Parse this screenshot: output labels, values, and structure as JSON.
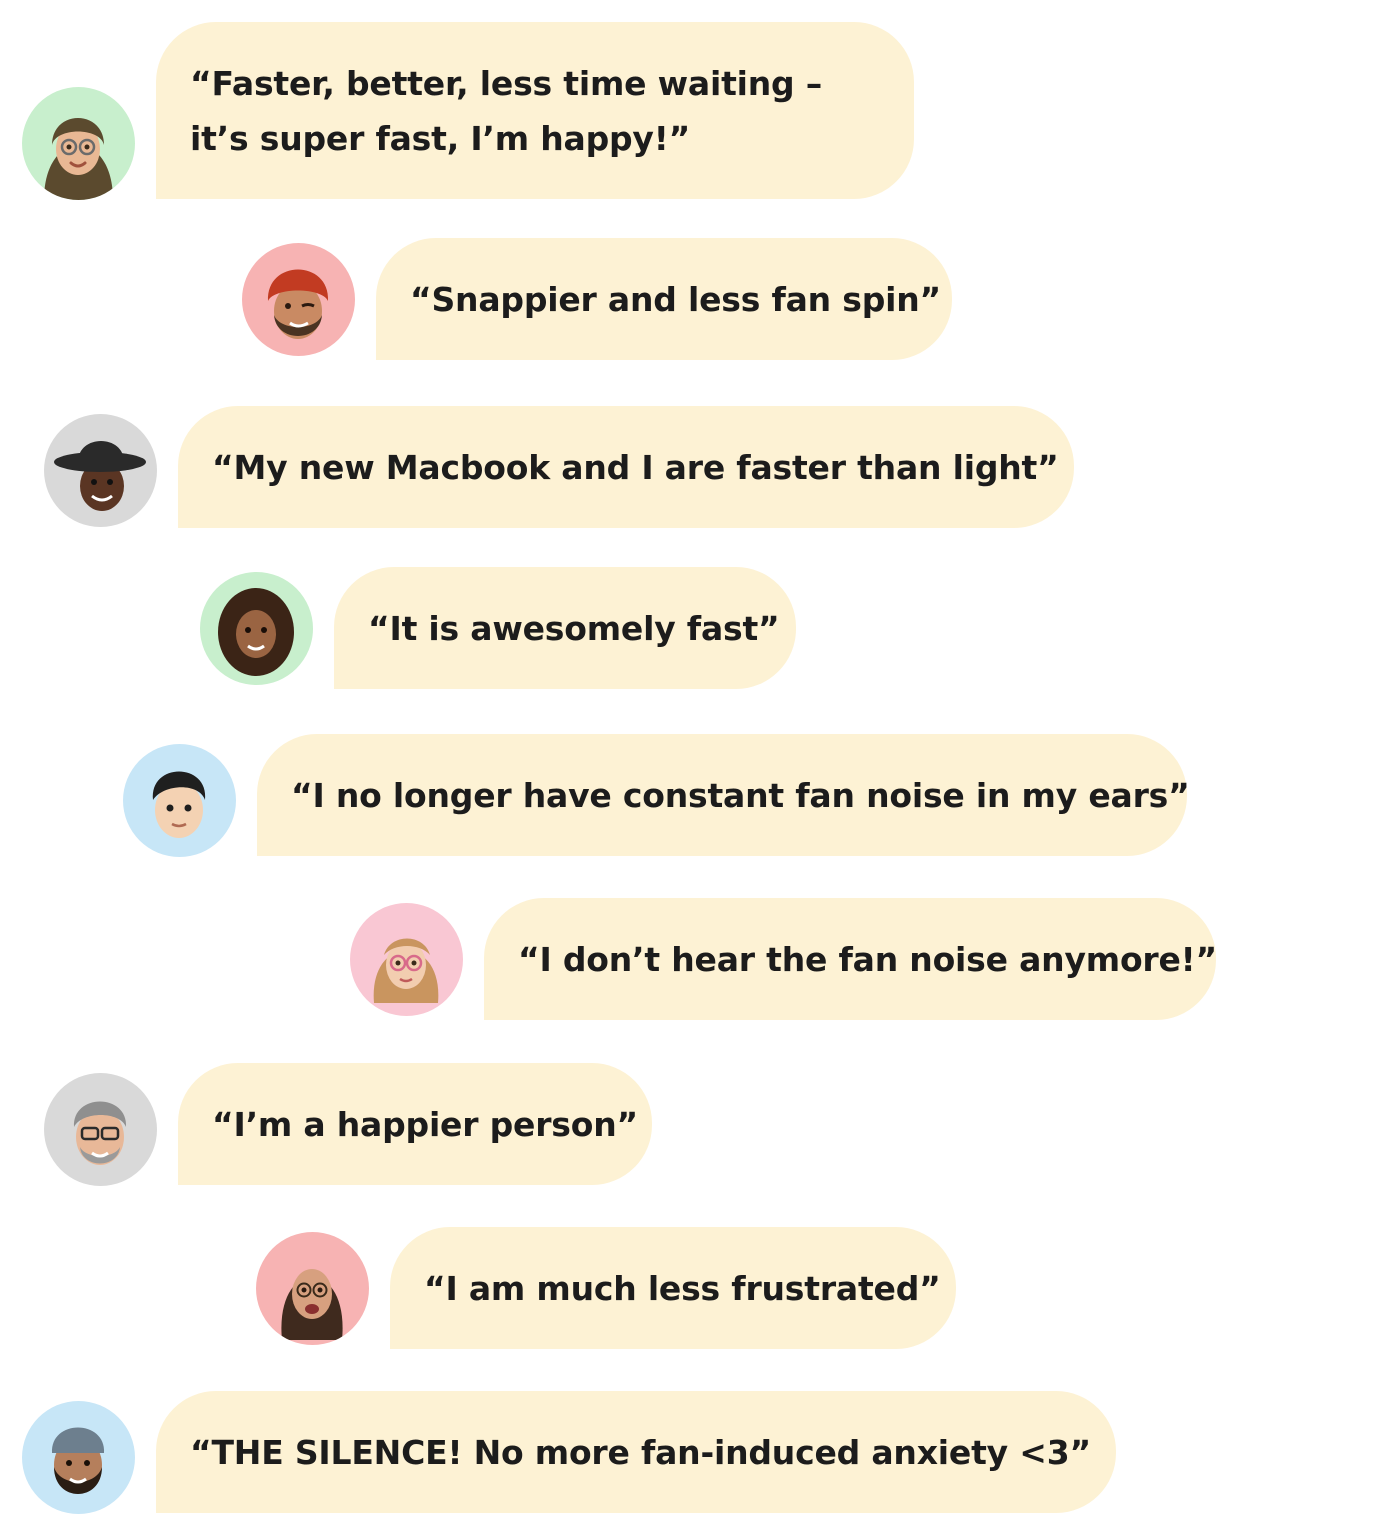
{
  "testimonials": [
    {
      "quote": "“Faster, better, less time waiting – it’s super fast, I’m happy!”",
      "avatar_icon": "memoji-woman-hijab-glasses-icon",
      "avatar_bg": "#c8efcd"
    },
    {
      "quote": "“Snappier and less fan spin”",
      "avatar_icon": "memoji-man-red-turban-winking-icon",
      "avatar_bg": "#f7b3b3"
    },
    {
      "quote": "“My new Macbook and I are faster than light”",
      "avatar_icon": "memoji-man-cowboy-hat-icon",
      "avatar_bg": "#d9d9d9"
    },
    {
      "quote": "“It is awesomely fast”",
      "avatar_icon": "memoji-woman-curly-hair-icon",
      "avatar_bg": "#c8efcd"
    },
    {
      "quote": "“I no longer have constant fan noise in my ears”",
      "avatar_icon": "memoji-boy-dark-hair-icon",
      "avatar_bg": "#c7e6f7"
    },
    {
      "quote": "“I don’t hear the fan noise anymore!”",
      "avatar_icon": "memoji-woman-blonde-glasses-icon",
      "avatar_bg": "#f9c7d3"
    },
    {
      "quote": "“I’m a happier person”",
      "avatar_icon": "memoji-man-grey-hair-glasses-icon",
      "avatar_bg": "#d9d9d9"
    },
    {
      "quote": "“I am much less frustrated”",
      "avatar_icon": "memoji-woman-brown-hair-glasses-icon",
      "avatar_bg": "#f7b3b3"
    },
    {
      "quote": "“THE SILENCE! No more fan-induced anxiety <3”",
      "avatar_icon": "memoji-man-beanie-beard-icon",
      "avatar_bg": "#c7e6f7"
    }
  ]
}
